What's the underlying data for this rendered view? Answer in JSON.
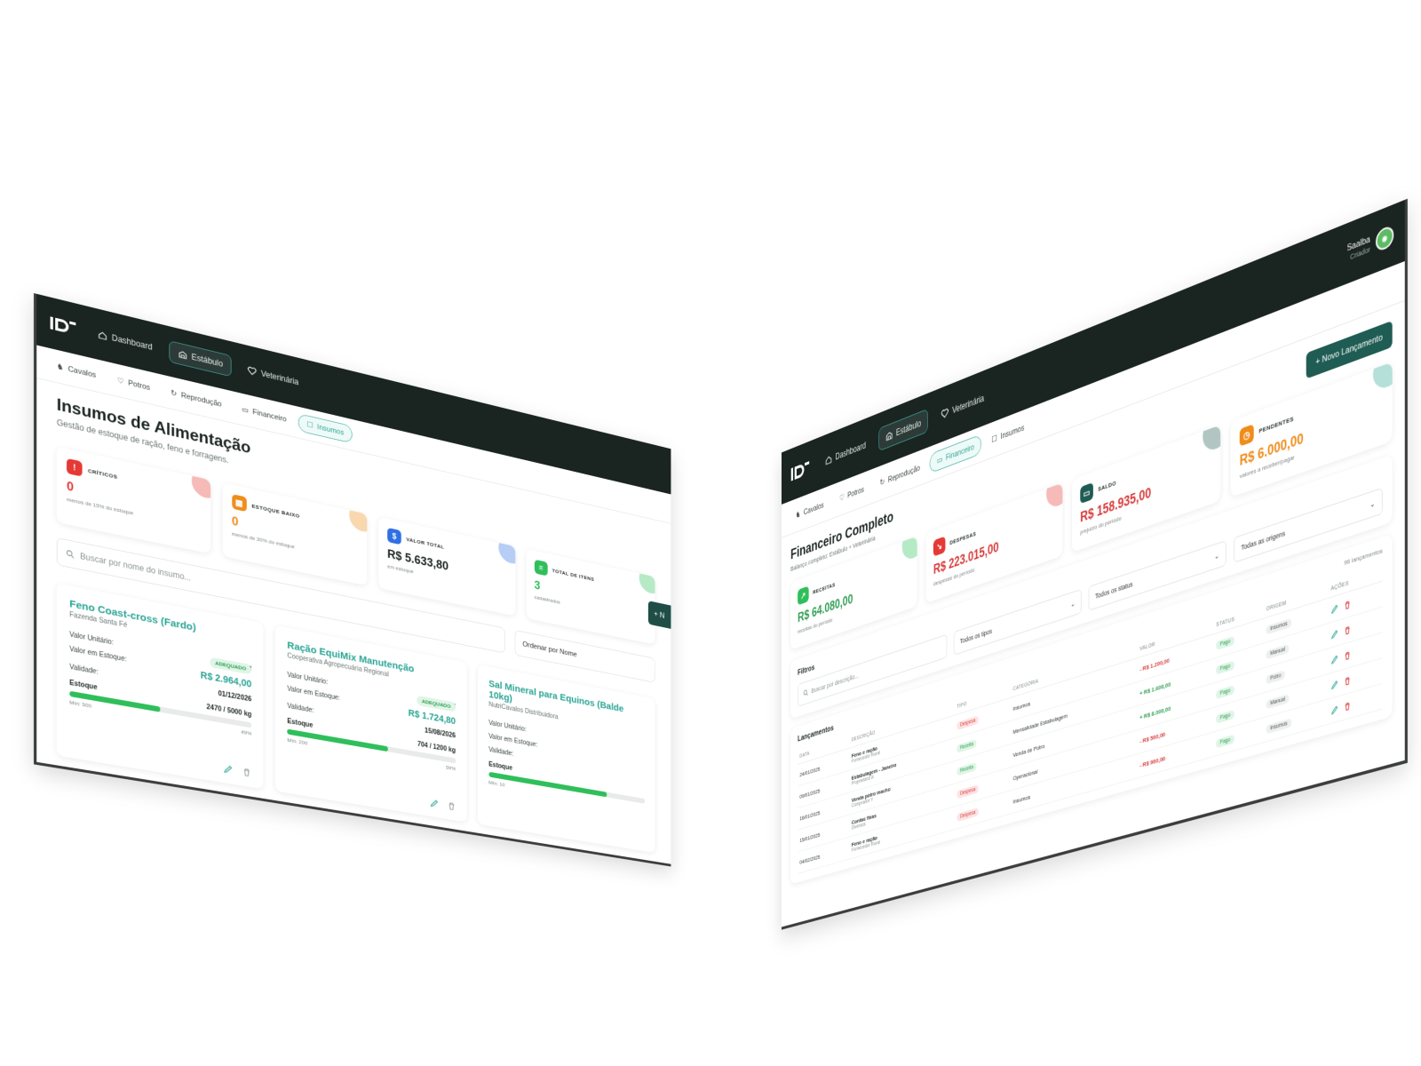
{
  "left": {
    "nav": {
      "items": [
        {
          "label": "Dashboard",
          "icon": "home-icon",
          "active": false
        },
        {
          "label": "Estábulo",
          "icon": "barn-icon",
          "active": true
        },
        {
          "label": "Veterinária",
          "icon": "heart-icon",
          "active": false
        }
      ]
    },
    "subnav": [
      {
        "label": "Cavalos",
        "icon": "horse-icon",
        "active": false
      },
      {
        "label": "Potros",
        "icon": "heart-icon",
        "active": false
      },
      {
        "label": "Reprodução",
        "icon": "cycle-icon",
        "active": false
      },
      {
        "label": "Financeiro",
        "icon": "wallet-icon",
        "active": false
      },
      {
        "label": "Insumos",
        "icon": "box-icon",
        "active": true
      }
    ],
    "title": "Insumos de Alimentação",
    "subtitle": "Gestão de estoque de ração, feno e forragens.",
    "new_button": "+ N",
    "stats": [
      {
        "label": "CRÍTICOS",
        "value": "0",
        "note": "menos de 15% do estoque",
        "color": "#e53935",
        "icon": "alert-icon",
        "value_color": "#e53935"
      },
      {
        "label": "ESTOQUE BAIXO",
        "value": "0",
        "note": "menos de 30% do estoque",
        "color": "#ef8c1a",
        "icon": "calendar-icon",
        "value_color": "#ef8c1a"
      },
      {
        "label": "VALOR TOTAL",
        "value": "R$ 5.633,80",
        "note": "em estoque",
        "color": "#2f6fe4",
        "icon": "dollar-icon",
        "value_color": "#1a2421"
      },
      {
        "label": "TOTAL DE ITENS",
        "value": "3",
        "note": "cadastrados",
        "color": "#2fbf5a",
        "icon": "list-icon",
        "value_color": "#2fbf5a"
      }
    ],
    "search_placeholder": "Buscar por nome do insumo...",
    "sort_label": "Ordenar por Nome",
    "items": [
      {
        "name": "Feno Coast-cross (Fardo)",
        "supplier": "Fazenda Santa Fé",
        "badge": "ADEQUADO",
        "unit_label": "Valor Unitário:",
        "unit_value": "R$ 1,20 / kg",
        "stock_value_label": "Valor em Estoque:",
        "stock_value": "R$ 2.964,00",
        "validity_label": "Validade:",
        "validity": "01/12/2026",
        "stock_label": "Estoque",
        "stock": "2470 / 5000 kg",
        "min": "Mín: 500",
        "percent_text": "49%",
        "percent": 49
      },
      {
        "name": "Ração EquiMix Manutenção",
        "supplier": "Cooperativa Agropecuária Regional",
        "badge": "ADEQUADO",
        "unit_label": "Valor Unitário:",
        "unit_value": "R$ 2,45 / kg",
        "stock_value_label": "Valor em Estoque:",
        "stock_value": "R$ 1.724,80",
        "validity_label": "Validade:",
        "validity": "15/08/2026",
        "stock_label": "Estoque",
        "stock": "704 / 1200 kg",
        "min": "Mín: 200",
        "percent_text": "59%",
        "percent": 59
      },
      {
        "name": "Sal Mineral para Equinos (Balde 10kg)",
        "supplier": "NutriCavalos Distribuidora",
        "badge": "",
        "unit_label": "Valor Unitário:",
        "unit_value": "",
        "stock_value_label": "Valor em Estoque:",
        "stock_value": "",
        "validity_label": "Validade:",
        "validity": "",
        "stock_label": "Estoque",
        "stock": "",
        "min": "Mín: 10",
        "percent_text": "",
        "percent": 75
      }
    ]
  },
  "right": {
    "nav": {
      "items": [
        {
          "label": "Dashboard",
          "icon": "home-icon",
          "active": false
        },
        {
          "label": "Estábulo",
          "icon": "barn-icon",
          "active": true
        },
        {
          "label": "Veterinária",
          "icon": "heart-icon",
          "active": false
        }
      ]
    },
    "user": {
      "name": "Saalba",
      "role": "Criador"
    },
    "subnav": [
      {
        "label": "Cavalos",
        "icon": "horse-icon",
        "active": false
      },
      {
        "label": "Potros",
        "icon": "heart-icon",
        "active": false
      },
      {
        "label": "Reprodução",
        "icon": "cycle-icon",
        "active": false
      },
      {
        "label": "Financeiro",
        "icon": "wallet-icon",
        "active": true
      },
      {
        "label": "Insumos",
        "icon": "box-icon",
        "active": false
      }
    ],
    "title": "Financeiro Completo",
    "subtitle": "Balanço completo: Estábulo + Veterinária",
    "new_button": "+ Novo Lançamento",
    "stats": [
      {
        "label": "RECEITAS",
        "value": "R$ 64.080,00",
        "note": "receitas do período",
        "color": "#2fbf5a",
        "value_color": "#2e9e52",
        "icon": "trend-up-icon"
      },
      {
        "label": "DESPESAS",
        "value": "R$ 223.015,00",
        "note": "despesas do período",
        "color": "#e53935",
        "value_color": "#d83a3a",
        "icon": "trend-down-icon"
      },
      {
        "label": "SALDO",
        "value": "R$ 158.935,00",
        "note": "prejuízo do período",
        "color": "#1f5c53",
        "value_color": "#d83a3a",
        "icon": "wallet-icon"
      },
      {
        "label": "PENDENTES",
        "value": "R$ 6.000,00",
        "note": "valores a receber/pagar",
        "color": "#ef8c1a",
        "value_color": "#ef8c1a",
        "icon": "clock-icon"
      }
    ],
    "filters": {
      "title": "Filtros",
      "search_placeholder": "Buscar por descrição...",
      "types": "Todos os tipos",
      "status": "Todos os status",
      "origins": "Todas as origens"
    },
    "table": {
      "title": "Lançamentos",
      "count": "96 lançamentos",
      "headers": [
        "DATA",
        "DESCRIÇÃO",
        "TIPO",
        "CATEGORIA",
        "VALOR",
        "STATUS",
        "ORIGEM",
        "AÇÕES"
      ],
      "rows": [
        {
          "date": "24/01/2025",
          "desc": "Feno e ração",
          "sub": "Fornecedor Rural",
          "type": "Despesa",
          "category": "Insumos",
          "value": "- R$ 1.200,00",
          "status": "Pago",
          "origin": "Insumos"
        },
        {
          "date": "09/01/2025",
          "desc": "Estabulagem - Janeiro",
          "sub": "Proprietário A",
          "type": "Receita",
          "category": "Mensalidade Estabulagem",
          "value": "+ R$ 1.600,00",
          "status": "Pago",
          "origin": "Manual"
        },
        {
          "date": "16/01/2025",
          "desc": "Venda potro macho",
          "sub": "Comprador Y",
          "type": "Receita",
          "category": "Venda de Potro",
          "value": "+ R$ 8.000,00",
          "status": "Pago",
          "origin": "Potro"
        },
        {
          "date": "15/01/2025",
          "desc": "Contas fixas",
          "sub": "Diversos",
          "type": "Despesa",
          "category": "Operacional",
          "value": "- R$ 500,00",
          "status": "Pago",
          "origin": "Manual"
        },
        {
          "date": "04/02/2025",
          "desc": "Feno e ração",
          "sub": "Fornecedor Rural",
          "type": "Despesa",
          "category": "Insumos",
          "value": "- R$ 900,00",
          "status": "Pago",
          "origin": "Insumos"
        }
      ]
    }
  }
}
